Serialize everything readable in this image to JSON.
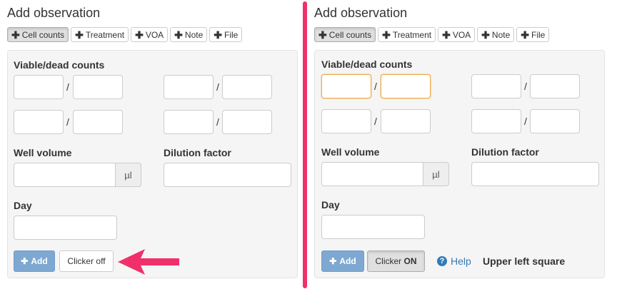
{
  "left": {
    "title": "Add observation",
    "tabs": [
      "Cell counts",
      "Treatment",
      "VOA",
      "Note",
      "File"
    ],
    "viable_dead_label": "Viable/dead counts",
    "separator": "/",
    "well_volume_label": "Well volume",
    "well_volume_unit": "µl",
    "dilution_label": "Dilution factor",
    "day_label": "Day",
    "add_label": "Add",
    "clicker_label": "Clicker off"
  },
  "right": {
    "title": "Add observation",
    "tabs": [
      "Cell counts",
      "Treatment",
      "VOA",
      "Note",
      "File"
    ],
    "viable_dead_label": "Viable/dead counts",
    "separator": "/",
    "well_volume_label": "Well volume",
    "well_volume_unit": "µl",
    "dilution_label": "Dilution factor",
    "day_label": "Day",
    "add_label": "Add",
    "clicker_prefix": "Clicker",
    "clicker_state": "ON",
    "help_label": "Help",
    "status_text": "Upper left square"
  },
  "colors": {
    "divider": "#f0306b",
    "arrow": "#f0306b",
    "add_button": "#7ea8d1",
    "focus_border": "#f0ad4e",
    "help_link": "#337ab7"
  },
  "icons": {
    "tab_icon": "plus-icon",
    "help_icon": "question-circle-icon",
    "annotation": "arrow-left-icon"
  }
}
